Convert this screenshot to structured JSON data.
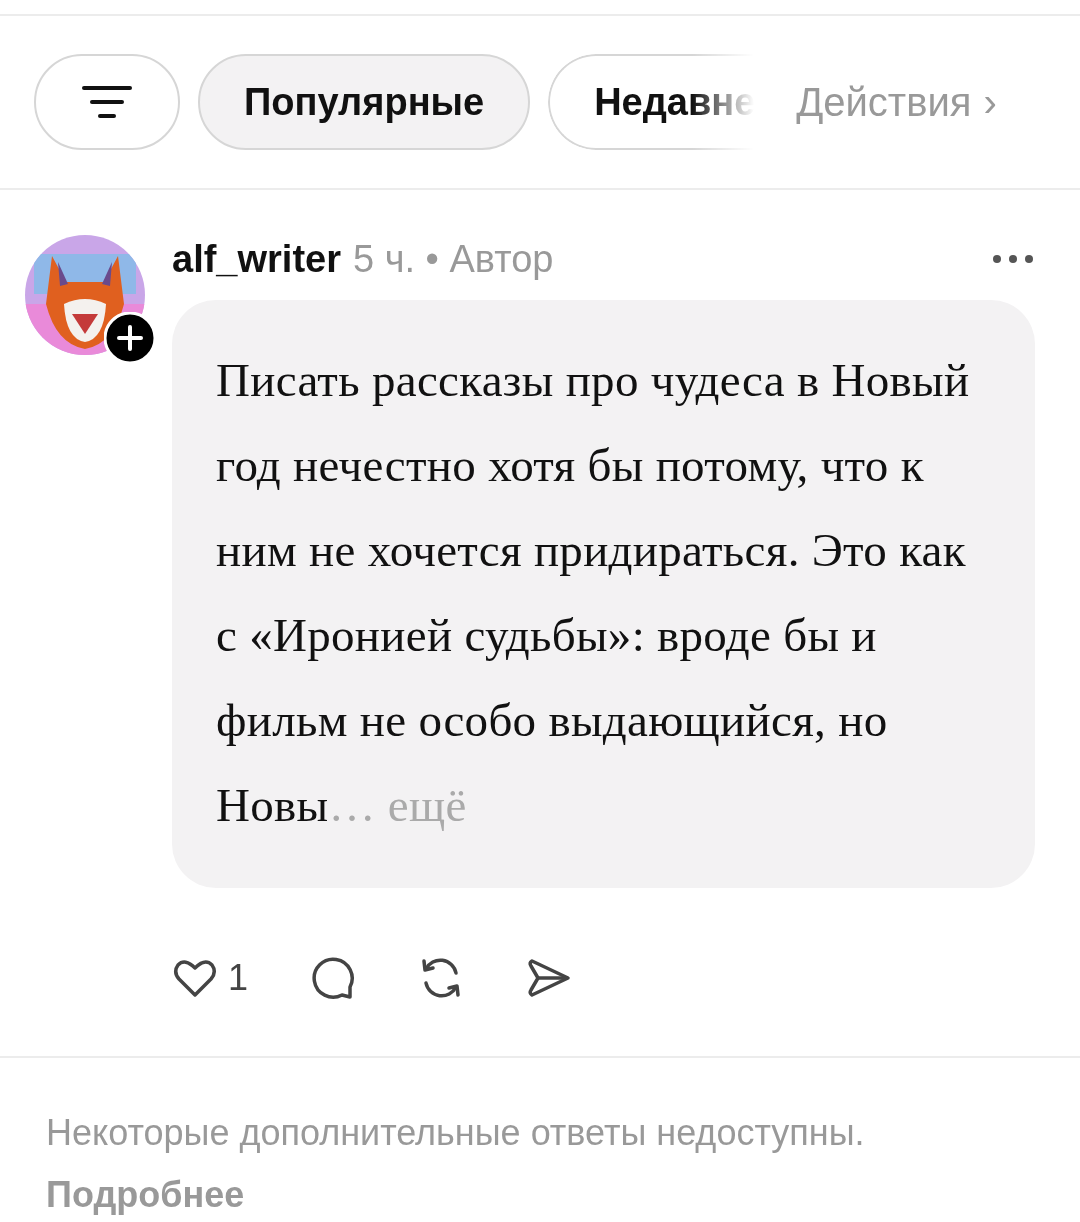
{
  "filters": [
    {
      "kind": "icon",
      "selected": false
    },
    {
      "kind": "chip",
      "label": "Популярные",
      "selected": true
    },
    {
      "kind": "chip",
      "label": "Недавне",
      "selected": false,
      "faded": true
    }
  ],
  "activity_link": {
    "label": "Действия",
    "chevron": "›"
  },
  "comment": {
    "avatar": {
      "kind": "picture",
      "follow_badge": true
    },
    "username": "alf_writer",
    "time": "5 ч.",
    "separator": "•",
    "role": "Автор",
    "text": "Писать рассказы про чудеса в Новый год нечестно хотя бы потому, что к ним не хочется придираться. Это как с «Иронией судьбы»: вроде бы и фильм не особо выдающийся, но Новы",
    "more": "… ещё",
    "likes": "1"
  },
  "footer": {
    "notice": "Некоторые дополнительные ответы недоступны.",
    "link": "Подробнее"
  }
}
